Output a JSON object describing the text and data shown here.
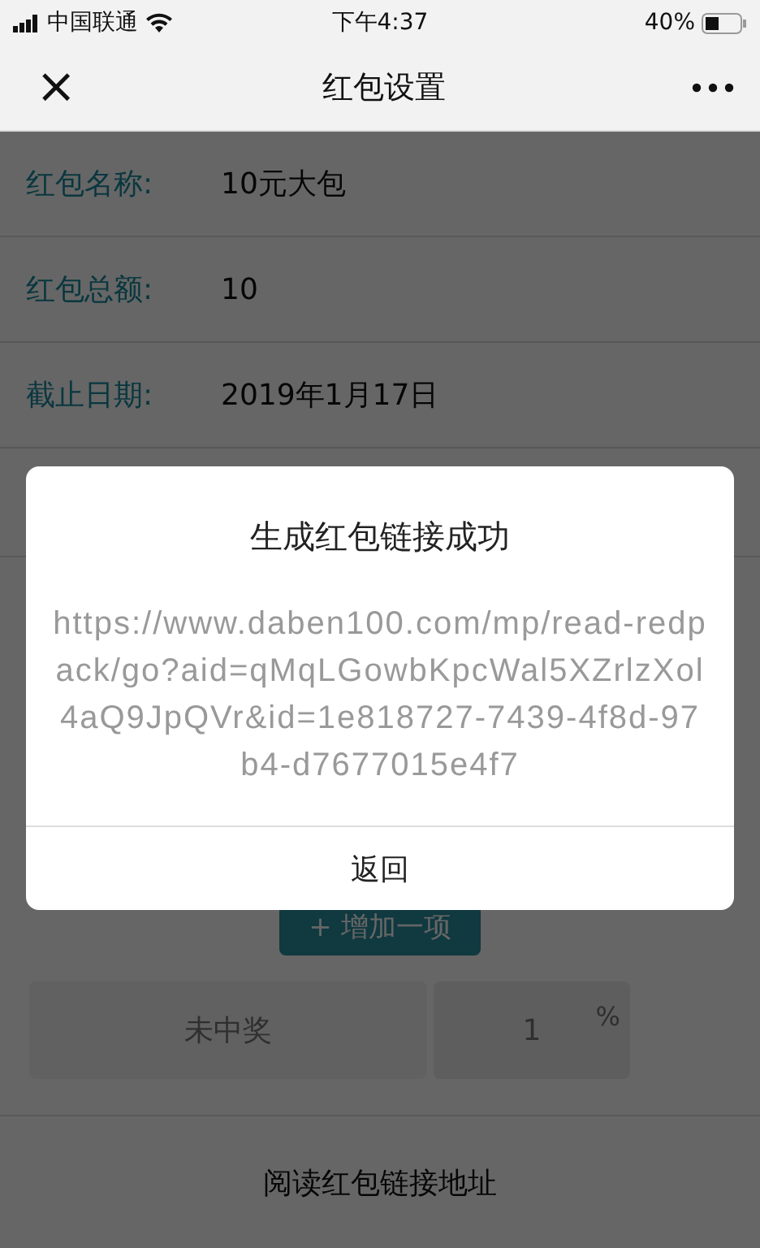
{
  "status_bar": {
    "carrier": "中国联通",
    "time": "下午4:37",
    "battery": "40%"
  },
  "nav": {
    "title": "红包设置",
    "close": "×"
  },
  "form": {
    "rows": [
      {
        "label": "红包名称:",
        "value": "10元大包"
      },
      {
        "label": "红包总额:",
        "value": "10"
      },
      {
        "label": "截止日期:",
        "value": "2019年1月17日"
      }
    ],
    "add_button": "+ 增加一项",
    "prize_rows": [
      {
        "name": "未中奖",
        "percent": "1",
        "unit": "%"
      }
    ],
    "footer_link": "阅读红包链接地址"
  },
  "dialog": {
    "title": "生成红包链接成功",
    "message": "https://www.daben100.com/mp/read-redpack/go?aid=qMqLGowbKpcWal5XZrlzXol4aQ9JpQVr&id=1e818727-7439-4f8d-97b4-d7677015e4f7",
    "button": "返回"
  }
}
